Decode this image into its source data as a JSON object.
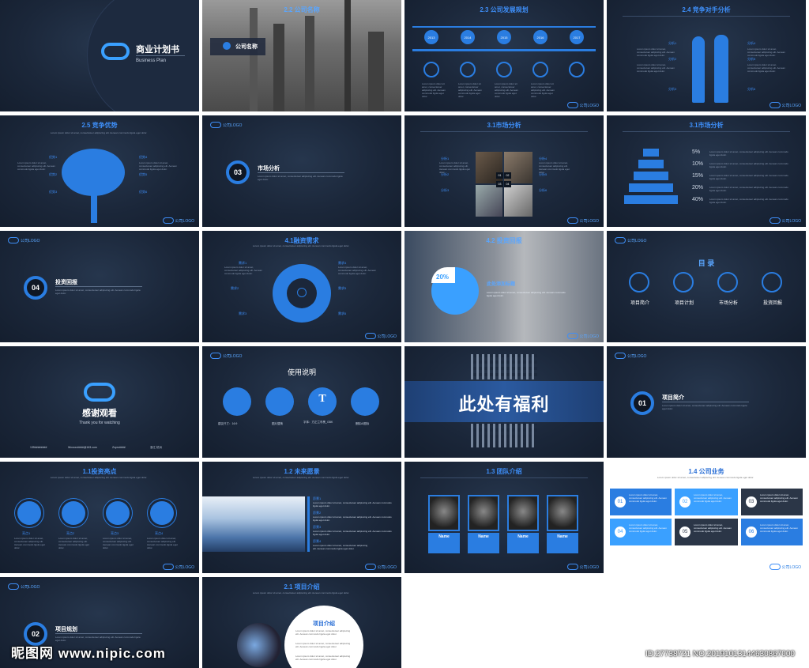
{
  "logo_text": "公司LOGO",
  "lorem": "Lorem ipsum dolor sit amet, consectetuer adipiscing elit. Aenean commodo ligula eget dolor.",
  "s1": {
    "title": "商业计划书",
    "subtitle": "Business Plan"
  },
  "s2": {
    "title": "2.2 公司名称",
    "company": "公司名称"
  },
  "s3": {
    "title": "2.3 公司发展规划",
    "years": [
      "2013",
      "2014",
      "2015",
      "2016",
      "2017"
    ]
  },
  "s4": {
    "title": "2.4 竞争对手分析",
    "labels": [
      "分析1",
      "分析2",
      "分析3",
      "分析4",
      "分析5",
      "分析6"
    ]
  },
  "s5": {
    "title": "2.5 竞争优势",
    "labels": [
      "优势1",
      "优势2",
      "优势3",
      "优势4",
      "优势5",
      "优势6"
    ]
  },
  "s6": {
    "number": "03",
    "heading": "市场分析"
  },
  "s7": {
    "title": "3.1市场分析",
    "labels": [
      "分析1",
      "分析2",
      "分析3",
      "分析4",
      "分析5",
      "分析6"
    ],
    "nums": [
      "01",
      "02",
      "03",
      "04"
    ]
  },
  "s8": {
    "title": "3.1市场分析",
    "percents": [
      "5%",
      "10%",
      "15%",
      "20%",
      "40%"
    ]
  },
  "s9": {
    "number": "04",
    "heading": "投资回报"
  },
  "s10": {
    "title": "4.1融资需求",
    "labels": [
      "需求1",
      "需求2",
      "需求3",
      "需求4",
      "需求5",
      "需求6"
    ]
  },
  "s11": {
    "title": "4.2 投资回报",
    "percent": "20%",
    "caption": "此处添加标题"
  },
  "s12": {
    "title": "目 录",
    "items": [
      "项目简介",
      "项目计划",
      "市场分析",
      "投资回报"
    ]
  },
  "s13": {
    "title": "感谢观看",
    "subtitle": "Thank you for watching",
    "contacts": [
      "135########",
      "Wxxxxx####@163.com",
      "Zxpro####",
      "浙江 杭州"
    ]
  },
  "s14": {
    "title": "使用说明",
    "captions": [
      "建议尺寸：16:9",
      "图片替换",
      "字体：方正兰亭黑_GBK",
      "删除AI图标"
    ]
  },
  "s15": {
    "text": "此处有福利"
  },
  "s16": {
    "number": "01",
    "heading": "项目简介"
  },
  "s17": {
    "title": "1.1投资亮点",
    "labels": [
      "亮点1",
      "亮点2",
      "亮点3",
      "亮点4"
    ]
  },
  "s18": {
    "title": "1.2 未来愿景",
    "labels": [
      "愿景1",
      "愿景2",
      "愿景3",
      "愿景4"
    ]
  },
  "s19": {
    "title": "1.3 团队介绍",
    "names": [
      "Name",
      "Name",
      "Name",
      "Name"
    ]
  },
  "s20": {
    "title": "1.4 公司业务",
    "nums": [
      "01",
      "02",
      "03",
      "04",
      "05",
      "06"
    ]
  },
  "s21": {
    "number": "02",
    "heading": "项目规划"
  },
  "s22": {
    "title": "2.1 项目介绍",
    "heading": "项目介绍"
  },
  "watermark": {
    "site": "昵图网 www.nipic.com",
    "id": "ID:27738721 NO:20191013144630867000"
  }
}
